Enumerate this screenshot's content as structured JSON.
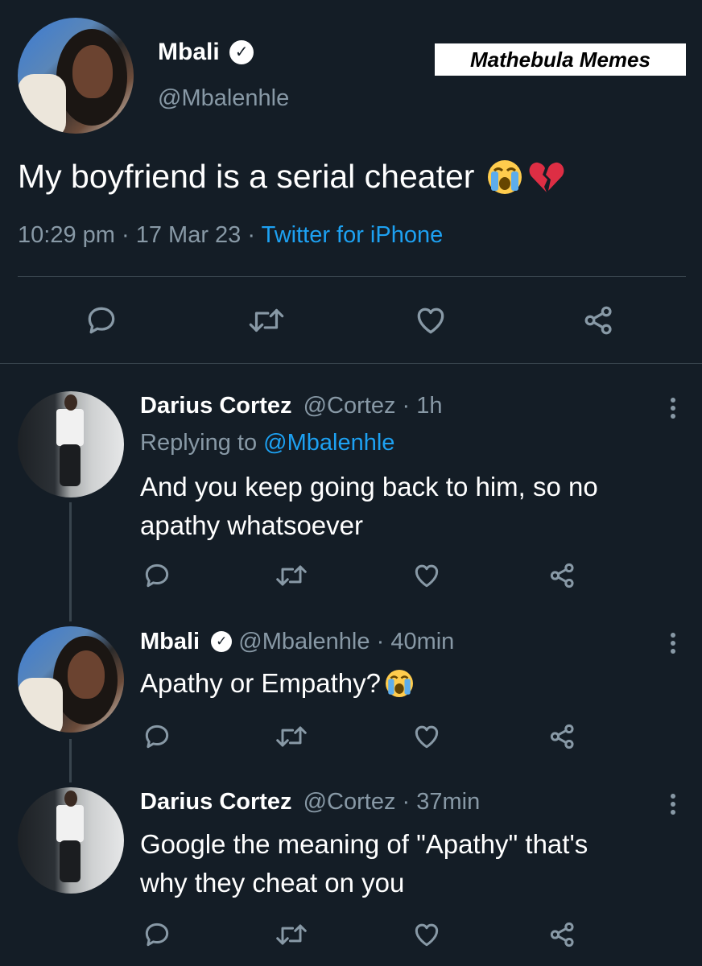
{
  "watermark": "Mathebula Memes",
  "main_tweet": {
    "author_name": "Mbali",
    "author_handle": "@Mbalenhle",
    "text": "My boyfriend is a serial cheater",
    "time": "10:29 pm",
    "date": "17 Mar 23",
    "source": "Twitter for iPhone",
    "separator": "·"
  },
  "replies": [
    {
      "author_name": "Darius Cortez",
      "author_handle": "@Cortez",
      "time": "1h",
      "replying_prefix": "Replying to",
      "replying_to": "@Mbalenhle",
      "text_line1": "And you keep going back to him, so no",
      "text_line2": "apathy whatsoever"
    },
    {
      "author_name": "Mbali",
      "author_handle": "@Mbalenhle",
      "time": "40min",
      "text_line1": "Apathy or Empathy?"
    },
    {
      "author_name": "Darius Cortez",
      "author_handle": "@Cortez",
      "time": "37min",
      "text_line1": "Google the meaning of \"Apathy\" that's",
      "text_line2": "why they cheat on you"
    }
  ],
  "icons": {
    "reply": "reply-icon",
    "retweet": "retweet-icon",
    "like": "heart-icon",
    "share": "share-icon",
    "more": "more-icon",
    "verified": "verified-badge-icon"
  },
  "colors": {
    "background": "#141d26",
    "link": "#1da1f2",
    "muted": "#8899a6",
    "divider": "#38444d"
  }
}
